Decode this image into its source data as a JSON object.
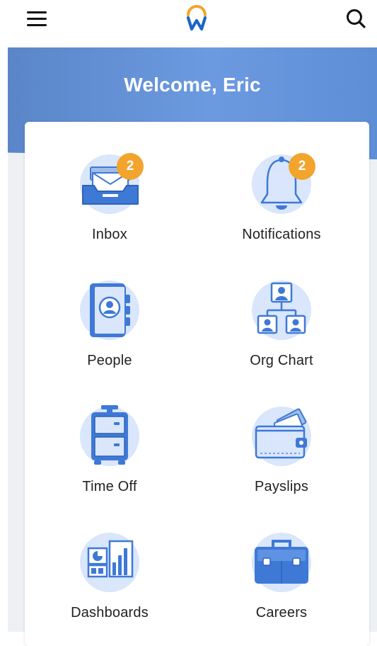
{
  "header": {
    "menu_icon": "hamburger-icon",
    "logo_icon": "workday-logo",
    "search_icon": "search-icon"
  },
  "hero": {
    "welcome_text": "Welcome, Eric"
  },
  "apps": [
    {
      "label": "Inbox",
      "icon": "inbox-icon",
      "badge": "2"
    },
    {
      "label": "Notifications",
      "icon": "bell-icon",
      "badge": "2"
    },
    {
      "label": "People",
      "icon": "address-book-icon"
    },
    {
      "label": "Org Chart",
      "icon": "org-chart-icon"
    },
    {
      "label": "Time Off",
      "icon": "suitcase-icon"
    },
    {
      "label": "Payslips",
      "icon": "wallet-icon"
    },
    {
      "label": "Dashboards",
      "icon": "dashboard-icon"
    },
    {
      "label": "Careers",
      "icon": "briefcase-icon"
    }
  ],
  "colors": {
    "accent": "#5a86c9",
    "badge": "#f3a42d",
    "icon_blue": "#3e79d6",
    "icon_light": "#d9e6fb"
  }
}
